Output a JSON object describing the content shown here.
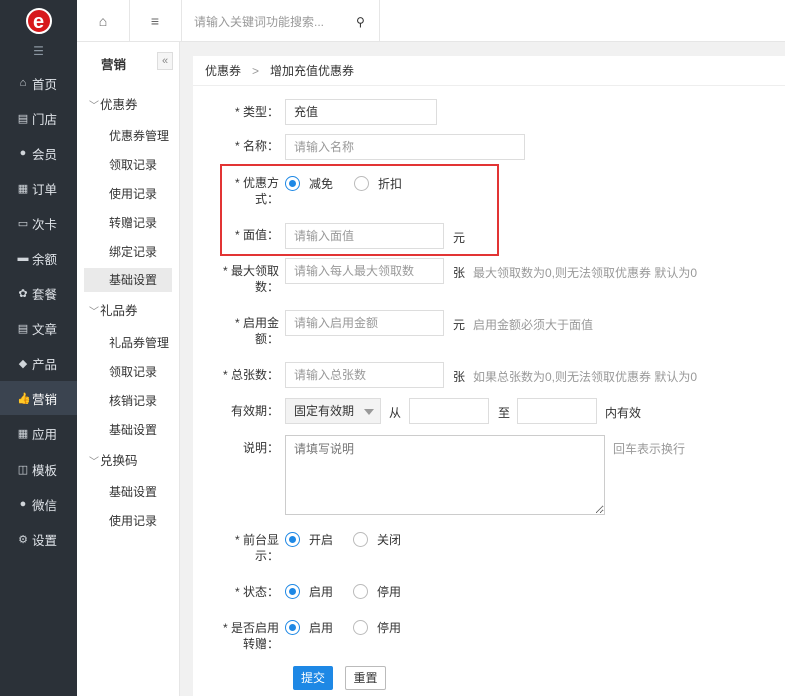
{
  "sidebar": {
    "fold_icon": "☰",
    "items": [
      {
        "icon": "home-icon",
        "glyph": "⌂",
        "label": "首页"
      },
      {
        "icon": "store-icon",
        "glyph": "▤",
        "label": "门店"
      },
      {
        "icon": "user-icon",
        "glyph": "●",
        "label": "会员"
      },
      {
        "icon": "order-icon",
        "glyph": "▦",
        "label": "订单"
      },
      {
        "icon": "card-icon",
        "glyph": "▭",
        "label": "次卡"
      },
      {
        "icon": "balance-icon",
        "glyph": "▬",
        "label": "余额"
      },
      {
        "icon": "package-icon",
        "glyph": "✿",
        "label": "套餐"
      },
      {
        "icon": "article-icon",
        "glyph": "▤",
        "label": "文章"
      },
      {
        "icon": "tag-icon",
        "glyph": "◆",
        "label": "产品"
      },
      {
        "icon": "thumb-up-icon",
        "glyph": "👍",
        "label": "营销"
      },
      {
        "icon": "grid-icon",
        "glyph": "▦",
        "label": "应用"
      },
      {
        "icon": "template-icon",
        "glyph": "◫",
        "label": "模板"
      },
      {
        "icon": "wechat-icon",
        "glyph": "●",
        "label": "微信"
      },
      {
        "icon": "settings-icon",
        "glyph": "⚙",
        "label": "设置"
      }
    ],
    "active_index": 9
  },
  "topbar": {
    "home_glyph": "⌂",
    "menu_glyph": "≡",
    "search_placeholder": "请输入关键词功能搜索...",
    "search_glyph": "⚲"
  },
  "subnav": {
    "title": "营销",
    "collapse_glyph": "«",
    "groups": [
      {
        "label": "优惠券",
        "items": [
          "优惠券管理",
          "领取记录",
          "使用记录",
          "转赠记录",
          "绑定记录",
          "基础设置"
        ]
      },
      {
        "label": "礼品券",
        "items": [
          "礼品券管理",
          "领取记录",
          "核销记录",
          "基础设置"
        ]
      },
      {
        "label": "兑换码",
        "items": [
          "基础设置",
          "使用记录"
        ]
      }
    ],
    "active": "基础设置"
  },
  "breadcrumb": {
    "parent": "优惠券",
    "separator": ">",
    "current": "增加充值优惠券"
  },
  "form": {
    "type_label": "* 类型：",
    "type_value": "充值",
    "name_label": "* 名称：",
    "name_placeholder": "请输入名称",
    "method_label_1": "* 优惠方",
    "method_label_2": "式：",
    "method_options": [
      "减免",
      "折扣"
    ],
    "method_selected": 0,
    "face_label": "* 面值：",
    "face_placeholder": "请输入面值",
    "face_unit": "元",
    "maxget_label_1": "* 最大领取",
    "maxget_label_2": "数：",
    "maxget_placeholder": "请输入每人最大领取数",
    "maxget_unit": "张",
    "maxget_hint": "最大领取数为0,则无法领取优惠券 默认为0",
    "enable_label_1": "* 启用金",
    "enable_label_2": "额：",
    "enable_placeholder": "请输入启用金额",
    "enable_unit": "元",
    "enable_hint": "启用金额必须大于面值",
    "total_label": "* 总张数：",
    "total_placeholder": "请输入总张数",
    "total_unit": "张",
    "total_hint": "如果总张数为0,则无法领取优惠券 默认为0",
    "valid_label": "有效期：",
    "valid_select": "固定有效期",
    "valid_from": "从",
    "valid_to": "至",
    "valid_suffix": "内有效",
    "desc_label": "说明：",
    "desc_placeholder": "请填写说明",
    "desc_hint": "回车表示换行",
    "front_label_1": "* 前台显",
    "front_label_2": "示：",
    "front_options": [
      "开启",
      "关闭"
    ],
    "front_selected": 0,
    "status_label": "* 状态：",
    "status_options": [
      "启用",
      "停用"
    ],
    "status_selected": 0,
    "transfer_label_1": "* 是否启用",
    "transfer_label_2": "转赠：",
    "transfer_options": [
      "启用",
      "停用"
    ],
    "transfer_selected": 0,
    "submit": "提交",
    "reset": "重置"
  },
  "colors": {
    "sidebar_bg": "#2b3138",
    "primary": "#1e88e5",
    "highlight_box": "#e23434"
  }
}
